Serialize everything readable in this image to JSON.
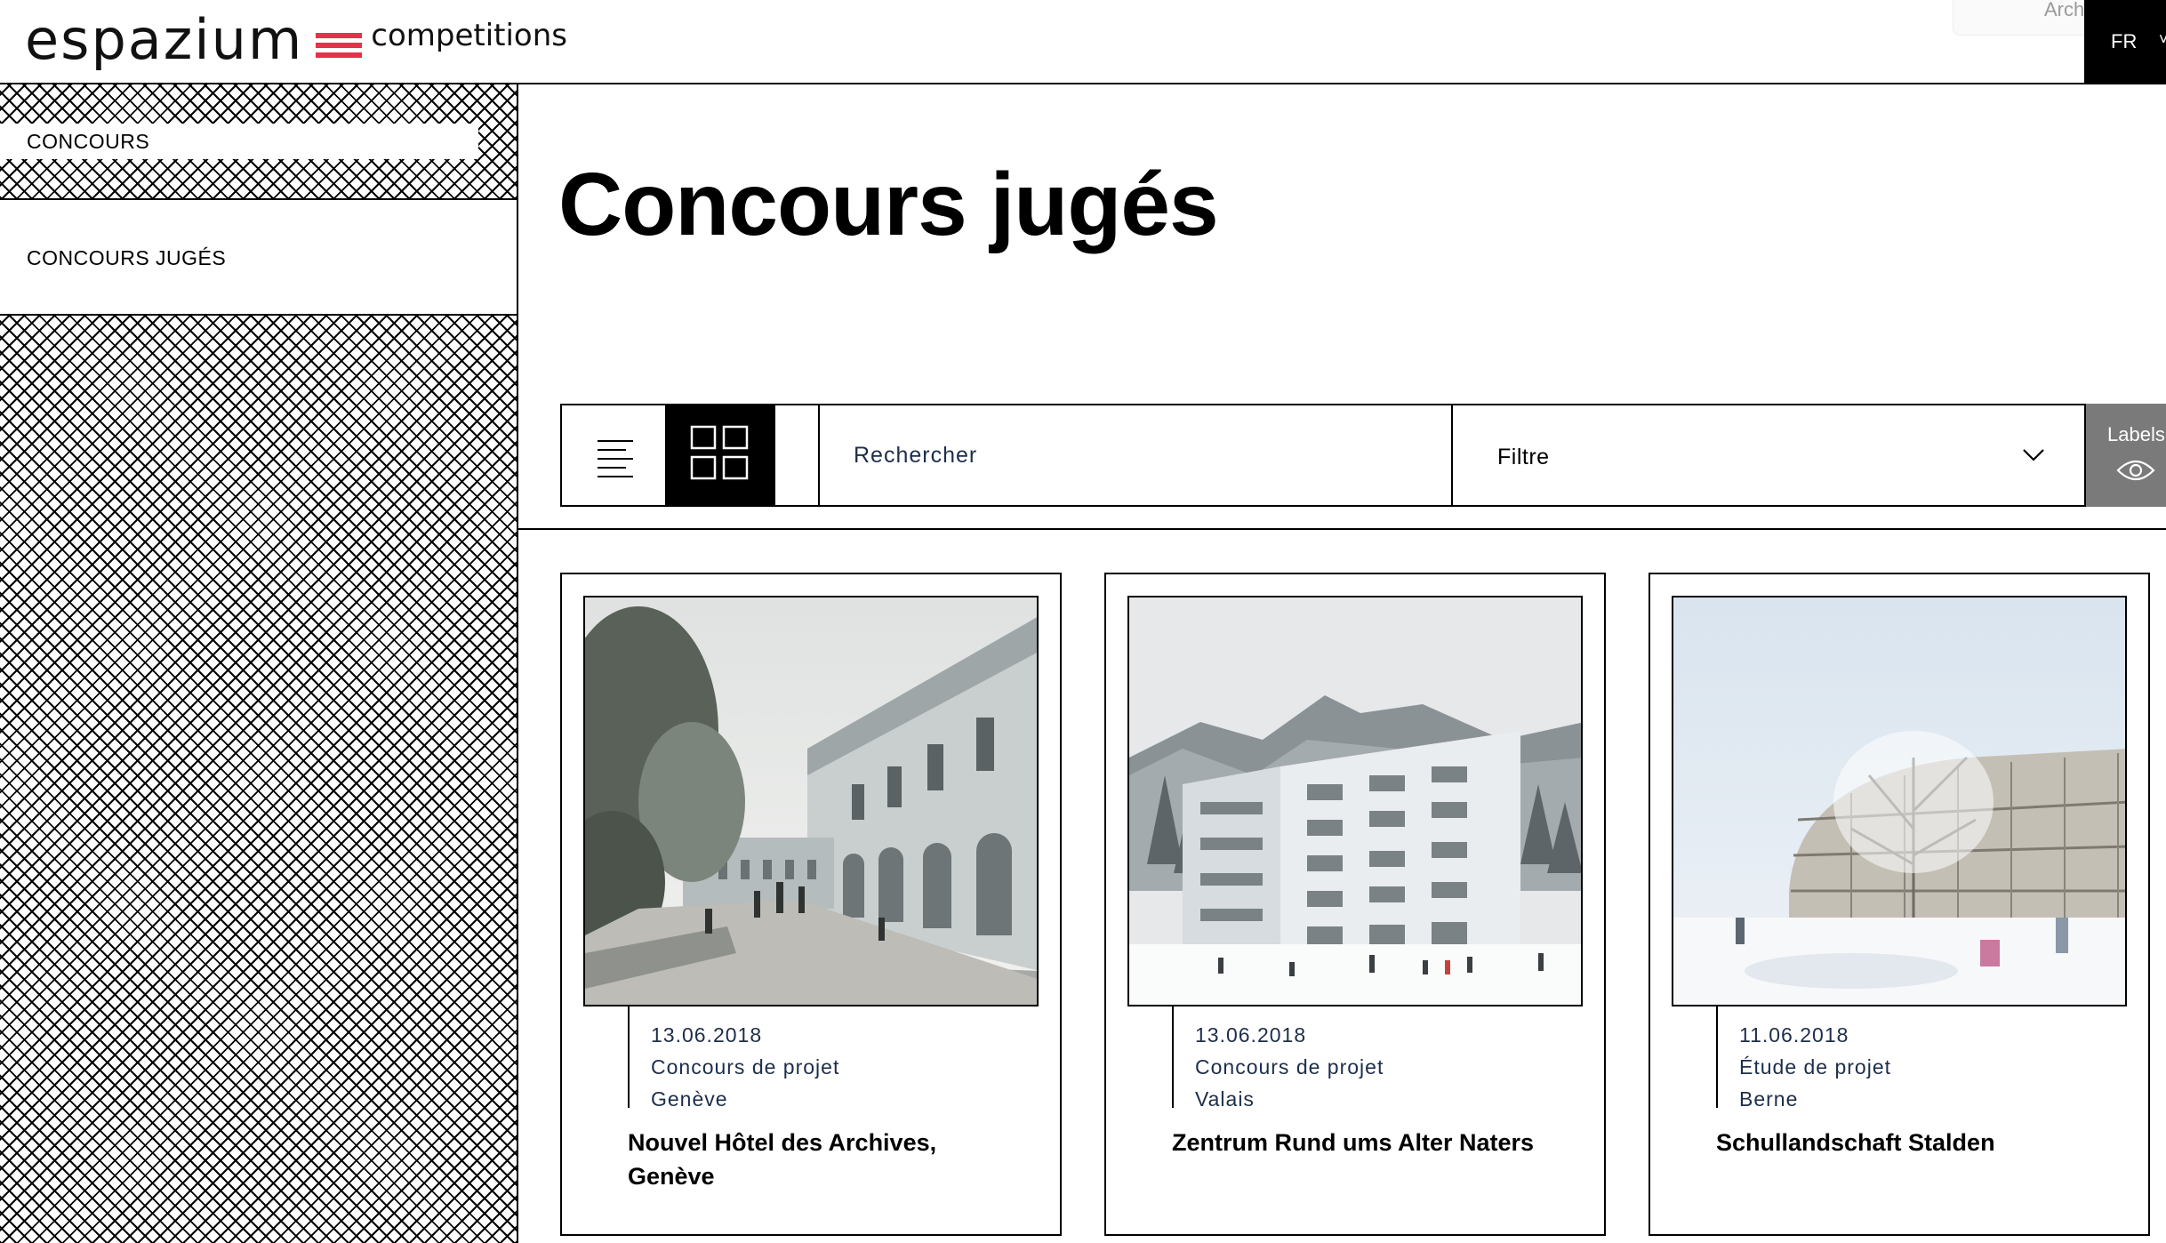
{
  "header": {
    "logo_word": "espazium",
    "logo_sub": "competitions",
    "ghost_text": "Architects' Jo",
    "lang": "FR",
    "lang_chevron": "˅"
  },
  "sidebar": {
    "current": "CONCOURS",
    "items": [
      {
        "label": "CONCOURS JUGÉS"
      }
    ]
  },
  "main": {
    "title": "Concours jugés"
  },
  "toolbar": {
    "search_placeholder": "Rechercher",
    "filter_label": "Filtre",
    "labels_label": "Labels",
    "icons": {
      "list": "list-view-icon",
      "grid": "grid-view-icon",
      "chevron": "chevron-down-icon",
      "eye": "eye-icon"
    }
  },
  "cards": [
    {
      "date": "13.06.2018",
      "type": "Concours de projet",
      "place": "Genève",
      "title": "Nouvel Hôtel des Archives, Genève"
    },
    {
      "date": "13.06.2018",
      "type": "Concours de projet",
      "place": "Valais",
      "title": "Zentrum Rund ums Alter Naters"
    },
    {
      "date": "11.06.2018",
      "type": "Étude de projet",
      "place": "Berne",
      "title": "Schullandschaft Stalden"
    }
  ],
  "colors": {
    "accent": "#e8304a",
    "meta_text": "#1d2e4a",
    "labels_bg": "#7a7a7a"
  }
}
